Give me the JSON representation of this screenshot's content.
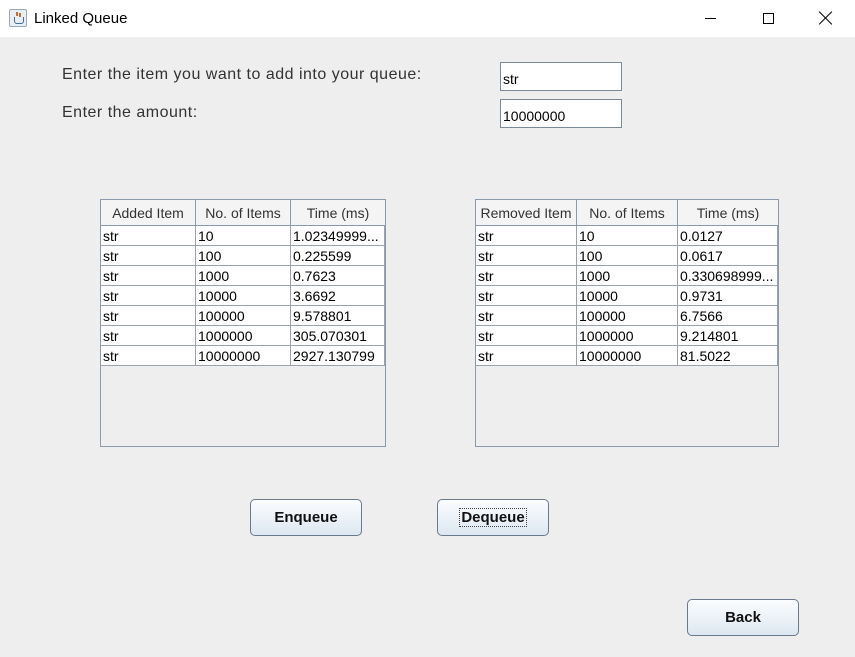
{
  "window": {
    "title": "Linked Queue",
    "icon": "java-coffee-cup-icon"
  },
  "form": {
    "item_label": "Enter the item you want to add into your queue:",
    "item_value": "str",
    "amount_label": "Enter the amount:",
    "amount_value": "10000000"
  },
  "added_table": {
    "headers": [
      "Added Item",
      "No. of Items",
      "Time (ms)"
    ],
    "rows": [
      [
        "str",
        "10",
        "1.02349999..."
      ],
      [
        "str",
        "100",
        "0.225599"
      ],
      [
        "str",
        "1000",
        "0.7623"
      ],
      [
        "str",
        "10000",
        "3.6692"
      ],
      [
        "str",
        "100000",
        "9.578801"
      ],
      [
        "str",
        "1000000",
        "305.070301"
      ],
      [
        "str",
        "10000000",
        "2927.130799"
      ]
    ]
  },
  "removed_table": {
    "headers": [
      "Removed Item",
      "No. of Items",
      "Time (ms)"
    ],
    "rows": [
      [
        "str",
        "10",
        "0.0127"
      ],
      [
        "str",
        "100",
        "0.0617"
      ],
      [
        "str",
        "1000",
        "0.330698999..."
      ],
      [
        "str",
        "10000",
        "0.9731"
      ],
      [
        "str",
        "100000",
        "6.7566"
      ],
      [
        "str",
        "1000000",
        "9.214801"
      ],
      [
        "str",
        "10000000",
        "81.5022"
      ]
    ]
  },
  "buttons": {
    "enqueue": "Enqueue",
    "dequeue": "Dequeue",
    "back": "Back"
  }
}
